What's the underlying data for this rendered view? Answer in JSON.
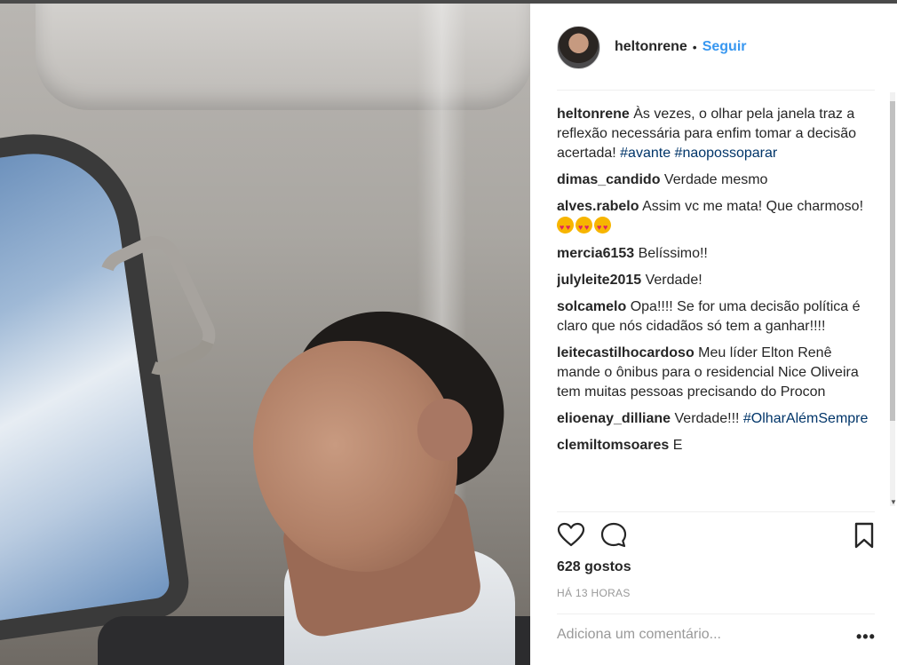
{
  "post": {
    "username": "heltonrene",
    "separator": "•",
    "follow_label": "Seguir",
    "caption": {
      "username": "heltonrene",
      "text": " Às vezes, o olhar pela janela traz a reflexão necessária para enfim tomar a decisão acertada! ",
      "tag1": "#avante",
      "tag2": "#naopossoparar"
    },
    "comments": [
      {
        "user": "dimas_candido",
        "text": " Verdade mesmo"
      },
      {
        "user": "alves.rabelo",
        "text": " Assim vc me mata! Que charmoso! "
      },
      {
        "user": "mercia6153",
        "text": " Belíssimo!!"
      },
      {
        "user": "julyleite2015",
        "text": " Verdade!"
      },
      {
        "user": "solcamelo",
        "text": " Opa!!!! Se for uma decisão política é claro que nós cidadãos só tem a ganhar!!!!"
      },
      {
        "user": "leitecastilhocardoso",
        "text": " Meu líder Elton Renê mande o ônibus para o residencial Nice Oliveira tem muitas pessoas precisando do Procon"
      },
      {
        "user": "elioenay_dilliane",
        "text": " Verdade!!! ",
        "tag": "#OlharAlémSempre"
      },
      {
        "user": "clemiltomsoares",
        "text": " E"
      }
    ],
    "likes": "628 gostos",
    "time": "HÁ 13 HORAS",
    "add_comment_placeholder": "Adiciona um comentário...",
    "more_label": "•••"
  },
  "icons": {
    "like": "heart-icon",
    "comment": "comment-bubble-icon",
    "save": "bookmark-icon",
    "emoji": "heart-eyes-emoji-icon"
  },
  "colors": {
    "link": "#3897f0",
    "hashtag": "#003569",
    "text": "#262626",
    "muted": "#999999"
  }
}
